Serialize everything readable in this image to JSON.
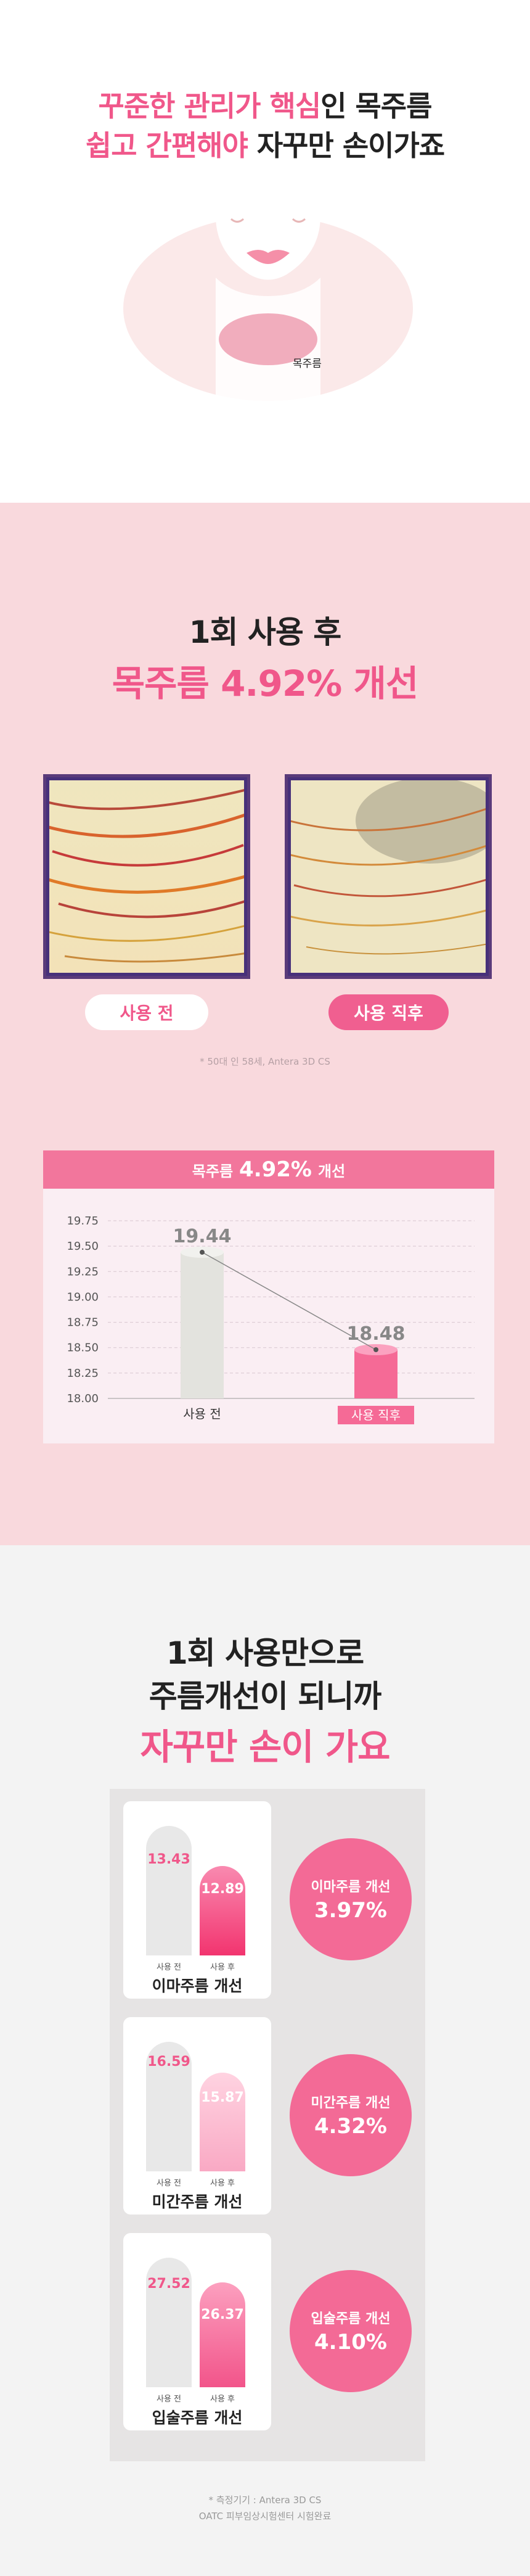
{
  "intro": {
    "line1_highlight": "꾸준한 관리가 핵심",
    "line1_rest": "인 목주름",
    "line2_highlight": "쉽고 간편해야",
    "line2_rest": " 자꾸만 손이가죠",
    "neck_label": "목주름"
  },
  "result": {
    "heading1": "1회 사용 후",
    "heading2": "목주름 4.92% 개선",
    "before_label": "사용 전",
    "after_label": "사용 직후",
    "note": "* 50대 인 58세, Antera 3D CS"
  },
  "chart_data": {
    "type": "line",
    "title_label": "목주름",
    "title_pct": "4.92%",
    "title_suffix": "개선",
    "categories": [
      "사용 전",
      "사용 직후"
    ],
    "values": [
      19.44,
      18.48
    ],
    "value_labels": [
      "19.44",
      "18.48"
    ],
    "yticks": [
      "19.75",
      "19.50",
      "19.25",
      "19.00",
      "18.75",
      "18.50",
      "18.25",
      "18.00"
    ],
    "ylim": [
      18.0,
      19.75
    ],
    "colors": {
      "before": "#e3e3de",
      "after": "#f56a96"
    }
  },
  "usage": {
    "heading1": "1회 사용만으로",
    "heading2": "주름개선이 되니까",
    "heading3": "자꾸만 손이 가요",
    "bar_before_label": "사용 전",
    "bar_after_label": "사용 후",
    "cards": [
      {
        "title": "이마주름 개선",
        "before": "13.43",
        "after": "12.89",
        "circle_title": "이마주름 개선",
        "circle_pct": "3.97%"
      },
      {
        "title": "미간주름 개선",
        "before": "16.59",
        "after": "15.87",
        "circle_title": "미간주름 개선",
        "circle_pct": "4.32%"
      },
      {
        "title": "입술주름 개선",
        "before": "27.52",
        "after": "26.37",
        "circle_title": "입술주름 개선",
        "circle_pct": "4.10%"
      }
    ],
    "note1": "* 측정기기 : Antera 3D CS",
    "note2": "OATC 피부임상시험센터 시험완료"
  }
}
